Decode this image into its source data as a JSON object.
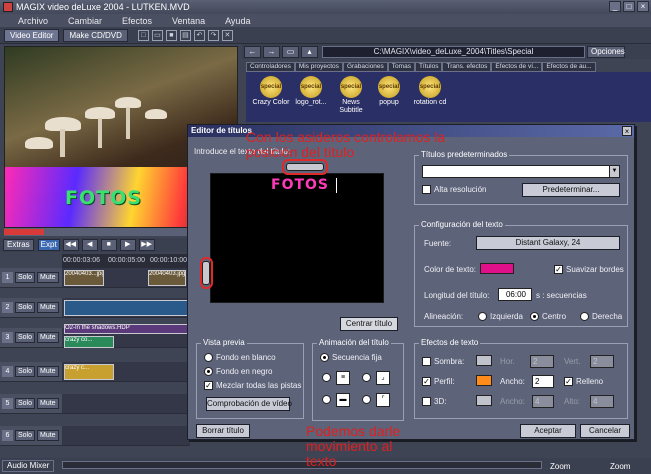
{
  "window": {
    "title": "MAGIX video deLuxe 2004 - LUTKEN.MVD",
    "btn_min": "_",
    "btn_max": "□",
    "btn_close": "×"
  },
  "menu": [
    "Archivo",
    "Cambiar",
    "Efectos",
    "Ventana",
    "Ayuda"
  ],
  "toolbar": {
    "tab_video_editor": "Video Editor",
    "tab_make_cd": "Make CD/DVD",
    "icons": [
      "new-icon",
      "open-icon",
      "save-icon",
      "print-icon",
      "undo-icon",
      "redo-icon",
      "delete-icon"
    ]
  },
  "preview": {
    "title_text": "FOTOS"
  },
  "browser": {
    "path": "C:\\MAGIX\\video_deLuxe_2004\\Titles\\Special",
    "options_label": "Opciones",
    "tabs": [
      "Controladores",
      "Mis proyectos",
      "Grabaciones",
      "Tomas",
      "Títulos",
      "Trans. efectos",
      "Efectos de ví...",
      "Efectos de au..."
    ],
    "items": [
      {
        "badge": "special",
        "label": "Crazy Color"
      },
      {
        "badge": "special",
        "label": "logo_rot..."
      },
      {
        "badge": "special",
        "label": "News Subtitle"
      },
      {
        "badge": "special",
        "label": "popup"
      },
      {
        "badge": "special",
        "label": "rotation cd"
      }
    ]
  },
  "timeline": {
    "extras_label": "Extras",
    "export_label": "Expt",
    "ruler": [
      "00:00:03:06",
      "00:00:05:00",
      "00:00:10:00"
    ],
    "tracks": [
      {
        "num": "1",
        "solo": "Solo",
        "mute": "Mute"
      },
      {
        "num": "2",
        "solo": "Solo",
        "mute": "Mute"
      },
      {
        "num": "3",
        "solo": "Solo",
        "mute": "Mute"
      },
      {
        "num": "4",
        "solo": "Solo",
        "mute": "Mute"
      },
      {
        "num": "5",
        "solo": "Solo",
        "mute": "Mute"
      },
      {
        "num": "6",
        "solo": "Solo",
        "mute": "Mute"
      }
    ],
    "clips": [
      "20040403...jpg",
      "20040403.jpg",
      "O2-In the shadows.HDP",
      "crazy co...",
      "crazy c..."
    ]
  },
  "status": {
    "audio_mixer": "Audio Mixer",
    "zoom1": "Zoom",
    "zoom2": "Zoom"
  },
  "dialog": {
    "title": "Editor de títulos",
    "close": "×",
    "intro_label": "Introduce el texto del título:",
    "text_content": "FOTOS",
    "center_btn": "Centrar título",
    "presets_group": "Títulos predeterminados",
    "high_res": "Alta resolución",
    "presets_btn": "Predeterminar...",
    "config_group": "Configuración del texto",
    "font_label": "Fuente:",
    "font_value": "Distant Galaxy, 24",
    "color_label": "Color de texto:",
    "text_color": "#e0108a",
    "smooth_edges": "Suavizar bordes",
    "length_label": "Longitud del título:",
    "length_value": "06:00",
    "length_unit": "s : secuencias",
    "align_label": "Alineación:",
    "align_left": "Izquierda",
    "align_center": "Centro",
    "align_right": "Derecha",
    "preview_group": "Vista previa",
    "bg_white": "Fondo en blanco",
    "bg_black": "Fondo en negro",
    "mix_tracks": "Mezclar todas las pistas",
    "check_video_btn": "Comprobación de vídeo",
    "anim_group": "Animación del título",
    "anim_fixed": "Secuencia fija",
    "effects_group": "Efectos de texto",
    "shadow": "Sombra:",
    "outline": "Perfil:",
    "d3": "3D:",
    "hor": "Hor.",
    "vert": "Vert.",
    "ancho": "Ancho:",
    "ancho2": "Ancho:",
    "alto": "Alto:",
    "relleno": "Relleno",
    "val_hor": "2",
    "val_vert": "2",
    "val_ancho": "2",
    "val_ancho2": "4",
    "val_alto": "4",
    "outline_color": "#ff8c1a",
    "delete_btn": "Borrar título",
    "accept_btn": "Aceptar",
    "cancel_btn": "Cancelar"
  },
  "annotations": {
    "top": "Con los asideros controlamos la posición del título",
    "bottom": "Podemos darle movimiento al texto"
  }
}
